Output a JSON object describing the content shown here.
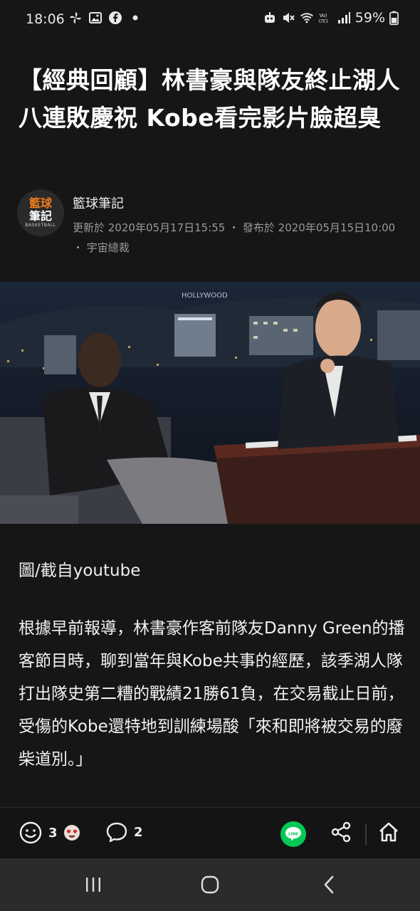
{
  "status_bar": {
    "time": "18:06",
    "battery": "59%",
    "icons_left": [
      "pinwheel-icon",
      "gallery-icon",
      "facebook-icon",
      "dot-icon"
    ],
    "icons_right": [
      "robot-icon",
      "mute-icon",
      "wifi-icon",
      "volte-icon",
      "signal-icon",
      "battery-icon"
    ]
  },
  "article": {
    "title": "【經典回顧】林書豪與隊友終止湖人八連敗慶祝 Kobe看完影片臉超臭",
    "author": "籃球筆記",
    "avatar_line1": "籃球",
    "avatar_line2": "筆記",
    "avatar_line3": "BASKETBALL",
    "meta": "更新於 2020年05月17日15:55 ・ 發布於 2020年05月15日10:00 ・ 宇宙總裁",
    "photo_sign": "HOLLYWOOD",
    "caption": "圖/截自youtube",
    "body": "根據早前報導，林書豪作客前隊友Danny Green的播客節目時，聊到當年與Kobe共事的經歷，該季湖人隊打出隊史第二糟的戰績21勝61負，在交易截止日前，受傷的Kobe還特地到訓練場酸「來和即將被交易的廢柴道別。」"
  },
  "actions": {
    "reaction_count": "3",
    "comment_count": "2"
  },
  "colors": {
    "background": "#161616",
    "line_green": "#06c755",
    "brand_orange": "#f07c1b"
  }
}
